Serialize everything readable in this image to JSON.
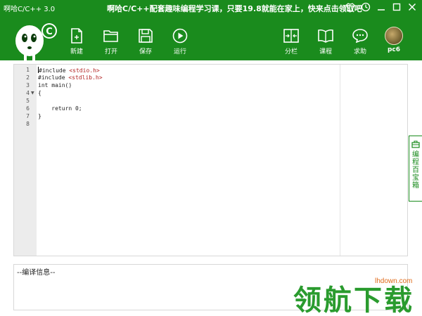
{
  "app": {
    "title": "啊哈C/C++ 3.0",
    "promo": "啊哈C/C++配套趣味编程学习课，只要19.8就能在家上，快来点击领取吧"
  },
  "window_controls": [
    "shirt-icon",
    "settings-icon",
    "minimize-icon",
    "maximize-icon",
    "close-icon"
  ],
  "toolbar": {
    "new_label": "新建",
    "open_label": "打开",
    "save_label": "保存",
    "run_label": "运行",
    "split_label": "分栏",
    "course_label": "课程",
    "help_label": "求助"
  },
  "user": {
    "name": "pc6"
  },
  "editor": {
    "line_numbers": [
      "1",
      "2",
      "3",
      "4",
      "5",
      "6",
      "7",
      "8"
    ],
    "lines": [
      {
        "kw": "#include ",
        "str": "<stdio.h>"
      },
      {
        "kw": "#include ",
        "str": "<stdlib.h>"
      },
      {
        "kw": "int main()",
        "str": ""
      },
      {
        "kw": "{",
        "str": ""
      },
      {
        "kw": "",
        "str": ""
      },
      {
        "kw": "    return 0;",
        "str": ""
      },
      {
        "kw": "}",
        "str": ""
      },
      {
        "kw": "",
        "str": ""
      }
    ]
  },
  "side_tab": {
    "label": "编程百宝箱"
  },
  "compile": {
    "header": "--编译信息--"
  },
  "watermark": {
    "main": "领航下载",
    "sub": "lhdown.com"
  },
  "colors": {
    "brand_green": "#1a8b1d",
    "string_red": "#b22222",
    "watermark_green": "#2a9b2e"
  }
}
